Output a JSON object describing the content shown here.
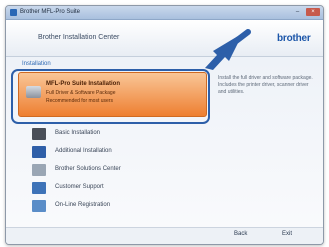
{
  "window": {
    "title": "Brother MFL-Pro Suite",
    "minimize_glyph": "–",
    "close_glyph": "×"
  },
  "header": {
    "title": "Brother Installation Center",
    "brand": "brother"
  },
  "main": {
    "section_label": "Installation",
    "highlighted": {
      "icon": "computer-cd-icon",
      "title": "MFL-Pro Suite Installation",
      "subtitle": "Full Driver & Software Package",
      "subtitle2": "Recommended for most users",
      "description": "Install the full driver and software package. Includes the printer driver, scanner driver and utilities."
    },
    "items": [
      {
        "icon": "printer-icon",
        "label": "Basic Installation",
        "color": "#4a4f58"
      },
      {
        "icon": "tools-icon",
        "label": "Additional Installation",
        "color": "#2f5fa8"
      },
      {
        "icon": "document-icon",
        "label": "Brother Solutions Center",
        "color": "#9aa6b4"
      },
      {
        "icon": "support-icon",
        "label": "Customer Support",
        "color": "#3e73b8"
      },
      {
        "icon": "registration-icon",
        "label": "On-Line Registration",
        "color": "#5a8dc8"
      }
    ]
  },
  "footer": {
    "back_label": "Back",
    "exit_label": "Exit"
  },
  "colors": {
    "accent": "#2d5fa9",
    "highlight": "#ee7f31",
    "brand": "#1c56a9"
  }
}
